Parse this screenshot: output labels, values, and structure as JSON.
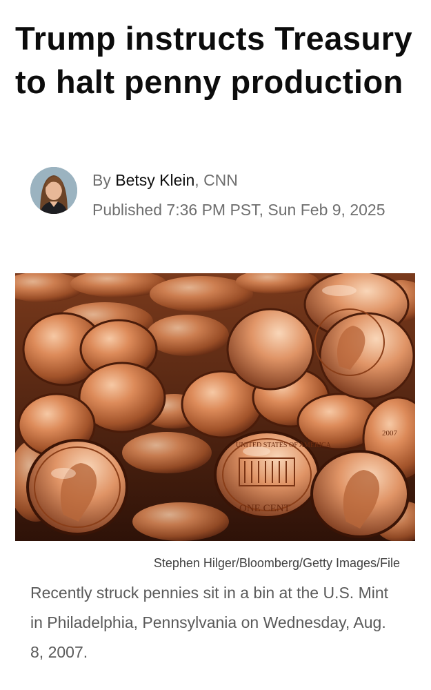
{
  "article": {
    "headline": "Trump instructs Treasury to halt penny production",
    "byline_prefix": "By",
    "author": "Betsy Klein",
    "outlet": ", CNN",
    "published": "Published 7:36 PM PST, Sun Feb 9, 2025"
  },
  "photo": {
    "credit": "Stephen Hilger/Bloomberg/Getty Images/File",
    "caption": "Recently struck pennies sit in a bin at the U.S. Mint in Philadelphia, Pennsylvania on Wednesday, Aug. 8, 2007.",
    "coin_inscriptions": {
      "one_cent": "ONE CENT",
      "usa": "UNITED STATES OF AMERICA",
      "year": "2007"
    }
  },
  "colors": {
    "headline": "#0c0c0c",
    "meta_gray": "#6e6e6e",
    "copper": "#c8703f",
    "copper_light": "#f2b48c",
    "copper_dark": "#5a2410"
  },
  "icons": {
    "avatar": "author-avatar"
  }
}
